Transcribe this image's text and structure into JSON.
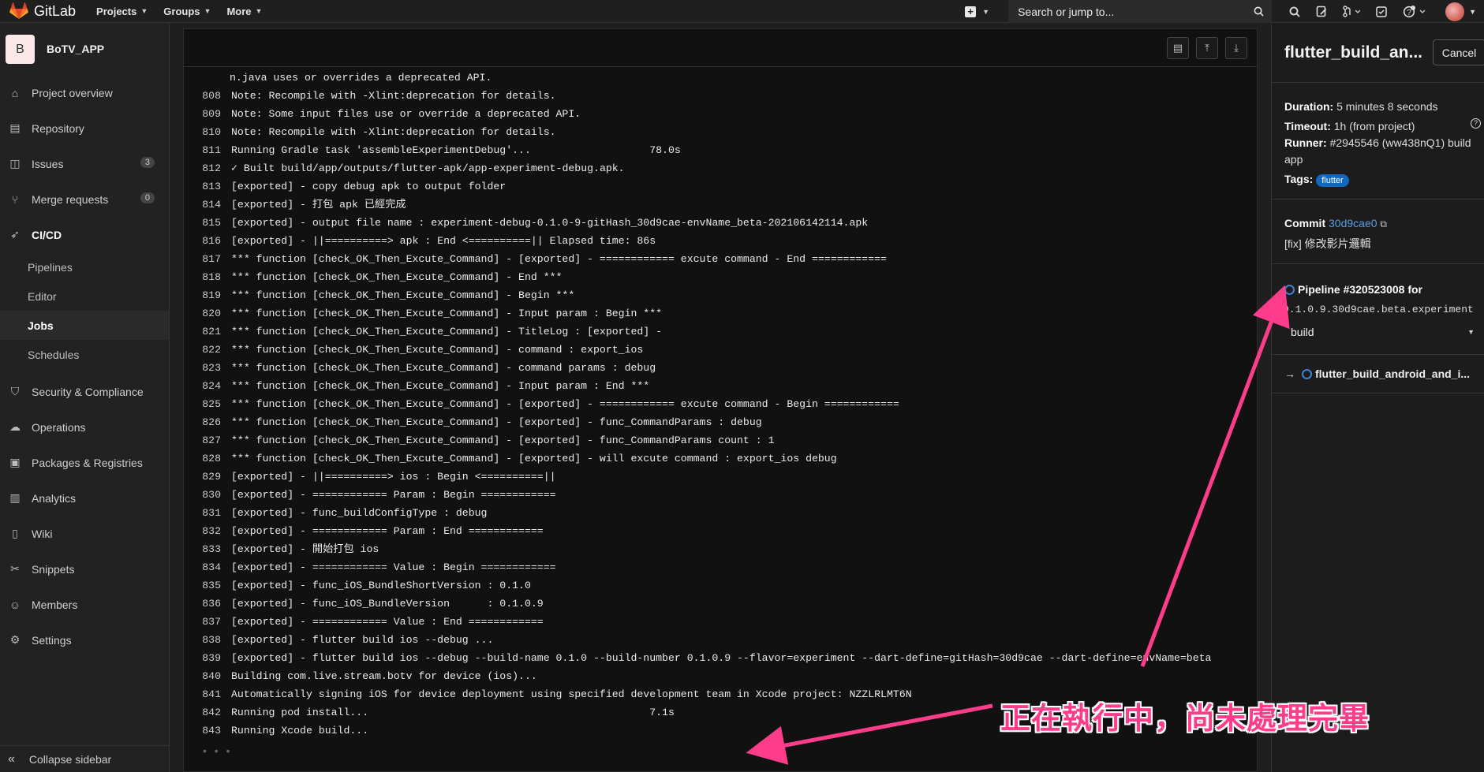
{
  "topbar": {
    "brand": "GitLab",
    "menus": [
      "Projects",
      "Groups",
      "More"
    ],
    "search_placeholder": "Search or jump to..."
  },
  "sidebar": {
    "project_initial": "B",
    "project_name": "BoTV_APP",
    "items": [
      {
        "label": "Project overview",
        "icon": "home-icon"
      },
      {
        "label": "Repository",
        "icon": "book-icon"
      },
      {
        "label": "Issues",
        "icon": "issues-icon",
        "badge": "3"
      },
      {
        "label": "Merge requests",
        "icon": "merge-request-icon",
        "badge": "0"
      },
      {
        "label": "CI/CD",
        "icon": "rocket-icon"
      }
    ],
    "cicd_sub": [
      "Pipelines",
      "Editor",
      "Jobs",
      "Schedules"
    ],
    "items2": [
      {
        "label": "Security & Compliance",
        "icon": "shield-icon"
      },
      {
        "label": "Operations",
        "icon": "cloud-icon"
      },
      {
        "label": "Packages & Registries",
        "icon": "package-icon"
      },
      {
        "label": "Analytics",
        "icon": "chart-icon"
      },
      {
        "label": "Wiki",
        "icon": "book-icon"
      },
      {
        "label": "Snippets",
        "icon": "scissors-icon"
      },
      {
        "label": "Members",
        "icon": "users-icon"
      },
      {
        "label": "Settings",
        "icon": "gear-icon"
      }
    ],
    "collapse_label": "Collapse sidebar"
  },
  "log": {
    "lines": [
      {
        "n": "",
        "t": "n.java uses or overrides a deprecated API."
      },
      {
        "n": "808",
        "t": "Note: Recompile with -Xlint:deprecation for details."
      },
      {
        "n": "809",
        "t": "Note: Some input files use or override a deprecated API."
      },
      {
        "n": "810",
        "t": "Note: Recompile with -Xlint:deprecation for details."
      },
      {
        "n": "811",
        "t": "Running Gradle task 'assembleExperimentDebug'...                   78.0s"
      },
      {
        "n": "812",
        "t": "✓ Built build/app/outputs/flutter-apk/app-experiment-debug.apk."
      },
      {
        "n": "813",
        "t": "[exported] - copy debug apk to output folder"
      },
      {
        "n": "814",
        "t": "[exported] - 打包 apk 已經完成"
      },
      {
        "n": "815",
        "t": "[exported] - output file name : experiment-debug-0.1.0-9-gitHash_30d9cae-envName_beta-202106142114.apk"
      },
      {
        "n": "816",
        "t": "[exported] - ||==========> apk : End <==========|| Elapsed time: 86s"
      },
      {
        "n": "817",
        "t": "*** function [check_OK_Then_Excute_Command] - [exported] - ============ excute command - End ============"
      },
      {
        "n": "818",
        "t": "*** function [check_OK_Then_Excute_Command] - End ***"
      },
      {
        "n": "819",
        "t": "*** function [check_OK_Then_Excute_Command] - Begin ***"
      },
      {
        "n": "820",
        "t": "*** function [check_OK_Then_Excute_Command] - Input param : Begin ***"
      },
      {
        "n": "821",
        "t": "*** function [check_OK_Then_Excute_Command] - TitleLog : [exported] -"
      },
      {
        "n": "822",
        "t": "*** function [check_OK_Then_Excute_Command] - command : export_ios"
      },
      {
        "n": "823",
        "t": "*** function [check_OK_Then_Excute_Command] - command params : debug"
      },
      {
        "n": "824",
        "t": "*** function [check_OK_Then_Excute_Command] - Input param : End ***"
      },
      {
        "n": "825",
        "t": "*** function [check_OK_Then_Excute_Command] - [exported] - ============ excute command - Begin ============"
      },
      {
        "n": "826",
        "t": "*** function [check_OK_Then_Excute_Command] - [exported] - func_CommandParams : debug"
      },
      {
        "n": "827",
        "t": "*** function [check_OK_Then_Excute_Command] - [exported] - func_CommandParams count : 1"
      },
      {
        "n": "828",
        "t": "*** function [check_OK_Then_Excute_Command] - [exported] - will excute command : export_ios debug"
      },
      {
        "n": "829",
        "t": "[exported] - ||==========> ios : Begin <==========||"
      },
      {
        "n": "830",
        "t": "[exported] - ============ Param : Begin ============"
      },
      {
        "n": "831",
        "t": "[exported] - func_buildConfigType : debug"
      },
      {
        "n": "832",
        "t": "[exported] - ============ Param : End ============"
      },
      {
        "n": "833",
        "t": "[exported] - 開始打包 ios"
      },
      {
        "n": "834",
        "t": "[exported] - ============ Value : Begin ============"
      },
      {
        "n": "835",
        "t": "[exported] - func_iOS_BundleShortVersion : 0.1.0"
      },
      {
        "n": "836",
        "t": "[exported] - func_iOS_BundleVersion      : 0.1.0.9"
      },
      {
        "n": "837",
        "t": "[exported] - ============ Value : End ============"
      },
      {
        "n": "838",
        "t": "[exported] - flutter build ios --debug ..."
      },
      {
        "n": "839",
        "t": "[exported] - flutter build ios --debug --build-name 0.1.0 --build-number 0.1.0.9 --flavor=experiment --dart-define=gitHash=30d9cae --dart-define=envName=beta"
      },
      {
        "n": "840",
        "t": "Building com.live.stream.botv for device (ios)..."
      },
      {
        "n": "841",
        "t": "Automatically signing iOS for device deployment using specified development team in Xcode project: NZZLRLMT6N"
      },
      {
        "n": "842",
        "t": "Running pod install...                                             7.1s"
      },
      {
        "n": "843",
        "t": "Running Xcode build..."
      }
    ],
    "loading": "• • •"
  },
  "job": {
    "title": "flutter_build_an...",
    "cancel_label": "Cancel",
    "duration_label": "Duration:",
    "duration_value": "5 minutes 8 seconds",
    "timeout_label": "Timeout:",
    "timeout_value": "1h (from project)",
    "runner_label": "Runner:",
    "runner_value": "#2945546 (ww438nQ1) build",
    "runner_value2": "app",
    "tags_label": "Tags:",
    "tag": "flutter",
    "commit_label": "Commit",
    "commit_sha": "30d9cae0",
    "commit_message": "[fix] 修改影片邏輯",
    "pipeline_label": "Pipeline #320523008 for",
    "pipeline_ref": "0.1.0.9.30d9cae.beta.experiment",
    "stage": "build",
    "job_link": "flutter_build_android_and_i..."
  },
  "annotation": {
    "text": "正在執行中，尚未處理完畢",
    "color": "#ff3d8b"
  }
}
